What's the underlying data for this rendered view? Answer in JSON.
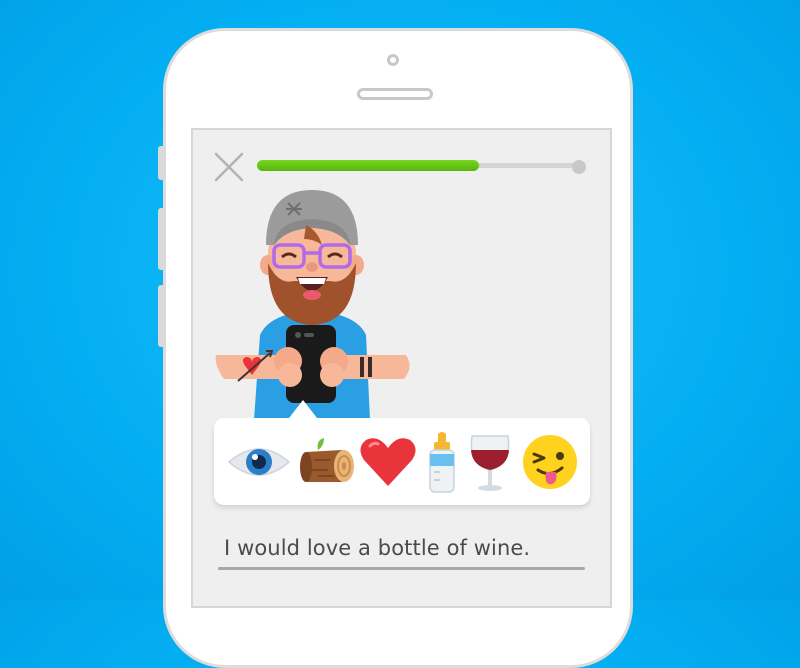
{
  "exercise": {
    "close_icon": "close-icon",
    "progress_fraction": 0.69,
    "progress_color": "#58b60b"
  },
  "emoji_options": [
    {
      "name": "eye-icon"
    },
    {
      "name": "log-icon"
    },
    {
      "name": "heart-icon"
    },
    {
      "name": "baby-bottle-icon"
    },
    {
      "name": "wine-glass-icon"
    },
    {
      "name": "tongue-wink-icon"
    }
  ],
  "answer": {
    "text": "I would love a bottle of wine."
  },
  "colors": {
    "background": "#04aef2",
    "progress": "#58b60b",
    "heart": "#e8343a"
  }
}
